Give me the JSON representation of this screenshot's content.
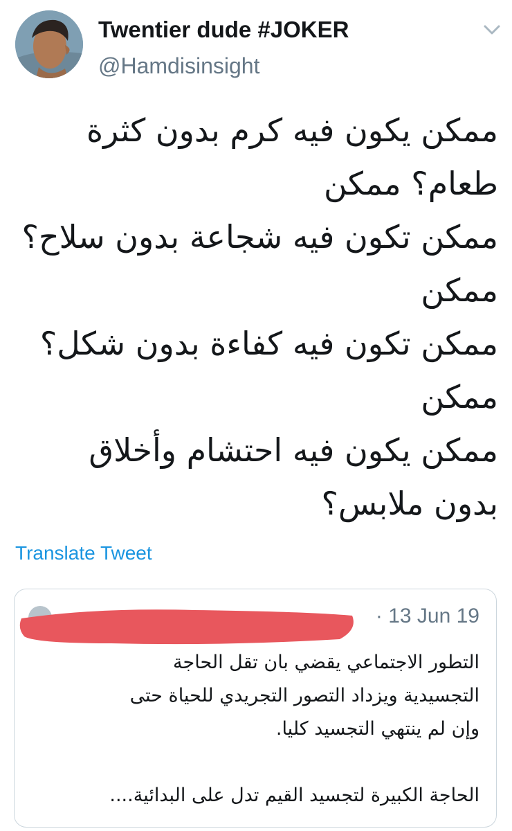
{
  "author": {
    "display_name": "Twentier dude #JOKER",
    "handle": "@Hamdisinsight"
  },
  "tweet": {
    "lines": [
      "ممكن يكون فيه كرم بدون كثرة",
      "طعام؟ ممكن",
      "ممكن تكون فيه شجاعة بدون سلاح؟",
      "ممكن",
      "ممكن تكون فيه كفاءة بدون شكل؟",
      "ممكن",
      "ممكن يكون فيه احتشام وأخلاق",
      "بدون ملابس؟"
    ]
  },
  "translate_label": "Translate Tweet",
  "quoted_tweet": {
    "date": "· 13 Jun 19",
    "lines": [
      "التطور الاجتماعي يقضي بان تقل الحاجة",
      "التجسيدية ويزداد التصور التجريدي للحياة حتى",
      "وإن لم ينتهي التجسيد كليا."
    ],
    "last_line": "الحاجة الكبيرة لتجسيد القيم تدل على البدائية...."
  },
  "colors": {
    "link": "#1b95e0",
    "secondary_text": "#657786",
    "border": "#ccd6dd",
    "redaction": "#e8575d"
  },
  "icons": {
    "menu": "chevron-down-icon"
  }
}
